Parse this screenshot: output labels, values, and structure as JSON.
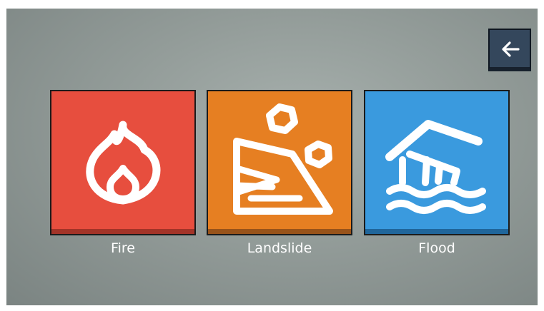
{
  "back_button": {
    "icon": "arrow-left-icon"
  },
  "tiles": [
    {
      "label": "Fire",
      "icon": "fire-icon",
      "color": "#e74e3e",
      "shade": "#a33428"
    },
    {
      "label": "Landslide",
      "icon": "landslide-icon",
      "color": "#e67f22",
      "shade": "#98531a"
    },
    {
      "label": "Flood",
      "icon": "flooded-house-icon",
      "color": "#3a9ade",
      "shade": "#20669b"
    }
  ]
}
